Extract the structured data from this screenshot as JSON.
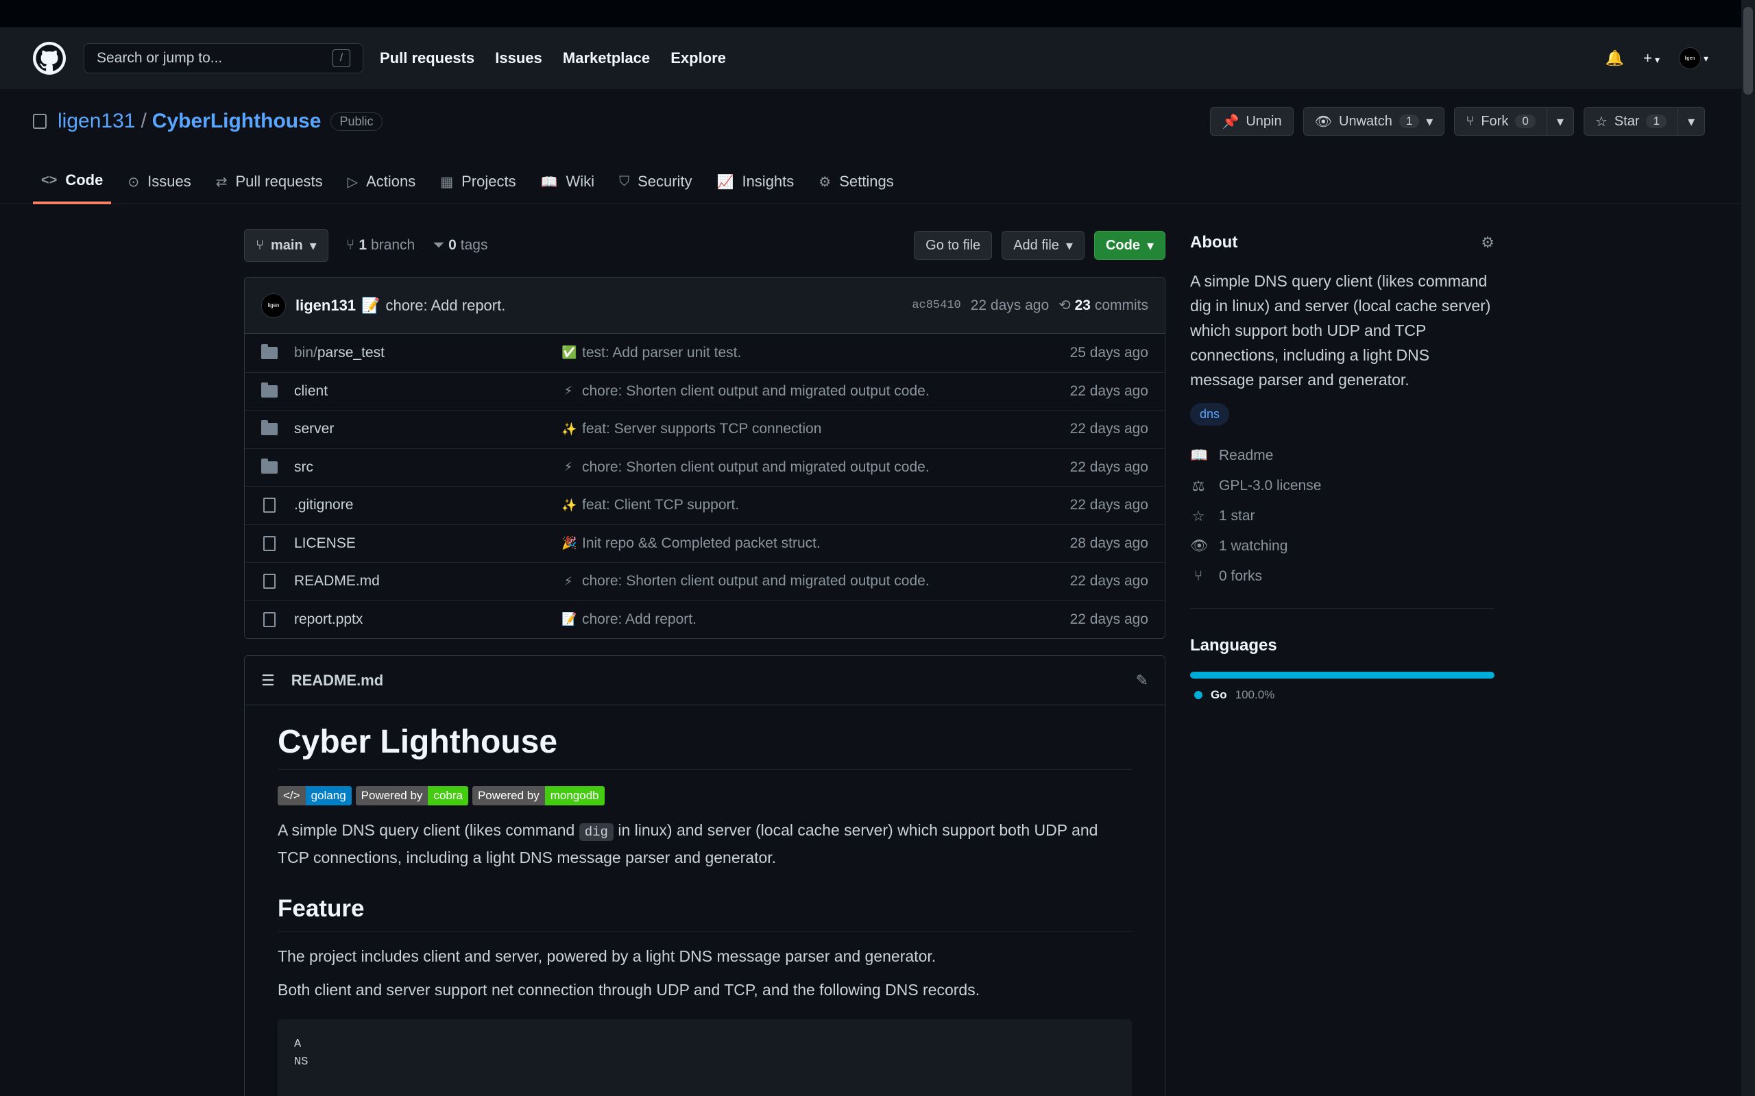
{
  "header": {
    "search_placeholder": "Search or jump to...",
    "search_shortcut": "/",
    "nav": [
      "Pull requests",
      "Issues",
      "Marketplace",
      "Explore"
    ],
    "avatar_text": "ligen"
  },
  "repo": {
    "owner": "ligen131",
    "separator": "/",
    "name": "CyberLighthouse",
    "visibility": "Public",
    "actions": {
      "unpin": "Unpin",
      "unwatch": "Unwatch",
      "watch_count": "1",
      "fork": "Fork",
      "fork_count": "0",
      "star": "Star",
      "star_count": "1"
    },
    "tabs": [
      "Code",
      "Issues",
      "Pull requests",
      "Actions",
      "Projects",
      "Wiki",
      "Security",
      "Insights",
      "Settings"
    ]
  },
  "toolbar": {
    "branch": "main",
    "branch_count": "1",
    "branch_label": "branch",
    "tag_count": "0",
    "tag_label": "tags",
    "goto_file": "Go to file",
    "add_file": "Add file",
    "code": "Code"
  },
  "commit": {
    "author": "ligen131",
    "avatar_text": "ligen",
    "message": "chore: Add report.",
    "sha": "ac85410",
    "age": "22 days ago",
    "count": "23",
    "count_label": "commits"
  },
  "files": [
    {
      "type": "dir",
      "prefix": "bin/",
      "name": "parse_test",
      "emoji": "✅",
      "message": "test: Add parser unit test.",
      "age": "25 days ago"
    },
    {
      "type": "dir",
      "prefix": "",
      "name": "client",
      "emoji": "⚡",
      "message": "chore: Shorten client output and migrated output code.",
      "age": "22 days ago"
    },
    {
      "type": "dir",
      "prefix": "",
      "name": "server",
      "emoji": "✨",
      "message": "feat: Server supports TCP connection",
      "age": "22 days ago"
    },
    {
      "type": "dir",
      "prefix": "",
      "name": "src",
      "emoji": "⚡",
      "message": "chore: Shorten client output and migrated output code.",
      "age": "22 days ago"
    },
    {
      "type": "file",
      "prefix": "",
      "name": ".gitignore",
      "emoji": "✨",
      "message": "feat: Client TCP support.",
      "age": "22 days ago"
    },
    {
      "type": "file",
      "prefix": "",
      "name": "LICENSE",
      "emoji": "🎉",
      "message": "Init repo && Completed packet struct.",
      "age": "28 days ago"
    },
    {
      "type": "file",
      "prefix": "",
      "name": "README.md",
      "emoji": "⚡",
      "message": "chore: Shorten client output and migrated output code.",
      "age": "22 days ago"
    },
    {
      "type": "file",
      "prefix": "",
      "name": "report.pptx",
      "emoji": "📝",
      "message": "chore: Add report.",
      "age": "22 days ago"
    }
  ],
  "readme": {
    "filename": "README.md",
    "title": "Cyber Lighthouse",
    "badges": [
      {
        "left": "</> ",
        "right": "golang",
        "color": "#007ec6"
      },
      {
        "left": "Powered by",
        "right": "cobra",
        "color": "#4c1"
      },
      {
        "left": "Powered by",
        "right": "mongodb",
        "color": "#4c1"
      }
    ],
    "intro_before": "A simple DNS query client (likes command ",
    "intro_code": "dig",
    "intro_after": " in linux) and server (local cache server) which support both UDP and TCP connections, including a light DNS message parser and generator.",
    "feature_heading": "Feature",
    "feature_p1": "The project includes client and server, powered by a light DNS message parser and generator.",
    "feature_p2": "Both client and server support net connection through UDP and TCP, and the following DNS records.",
    "records": "A\nNS"
  },
  "about": {
    "heading": "About",
    "description": "A simple DNS query client (likes command dig in linux) and server (local cache server) which support both UDP and TCP connections, including a light DNS message parser and generator.",
    "topic": "dns",
    "readme": "Readme",
    "license": "GPL-3.0 license",
    "stars": "1 star",
    "watching": "1 watching",
    "forks": "0 forks"
  },
  "languages": {
    "heading": "Languages",
    "items": [
      {
        "name": "Go",
        "percent": "100.0%",
        "color": "#00add8"
      }
    ]
  }
}
